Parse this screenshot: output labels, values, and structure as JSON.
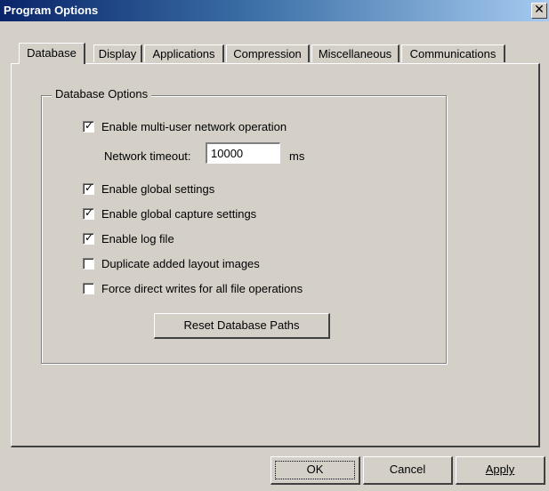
{
  "window": {
    "title": "Program Options",
    "close_glyph": "✕"
  },
  "tabs": [
    {
      "label": "Database",
      "active": true
    },
    {
      "label": "Display"
    },
    {
      "label": "Applications"
    },
    {
      "label": "Compression"
    },
    {
      "label": "Miscellaneous"
    },
    {
      "label": "Communications"
    }
  ],
  "database": {
    "group_label": "Database Options",
    "checkboxes": [
      {
        "label": "Enable multi-user network operation",
        "checked": true
      },
      {
        "label": "Enable global settings",
        "checked": true
      },
      {
        "label": "Enable global capture settings",
        "checked": true
      },
      {
        "label": "Enable log file",
        "checked": true
      },
      {
        "label": "Duplicate added layout images",
        "checked": false
      },
      {
        "label": "Force direct writes for all file operations",
        "checked": false
      }
    ],
    "network_timeout": {
      "label": "Network timeout:",
      "value": "10000",
      "unit": "ms"
    },
    "reset_button": "Reset Database Paths"
  },
  "footer": {
    "ok": "OK",
    "cancel": "Cancel",
    "apply": "Apply"
  }
}
